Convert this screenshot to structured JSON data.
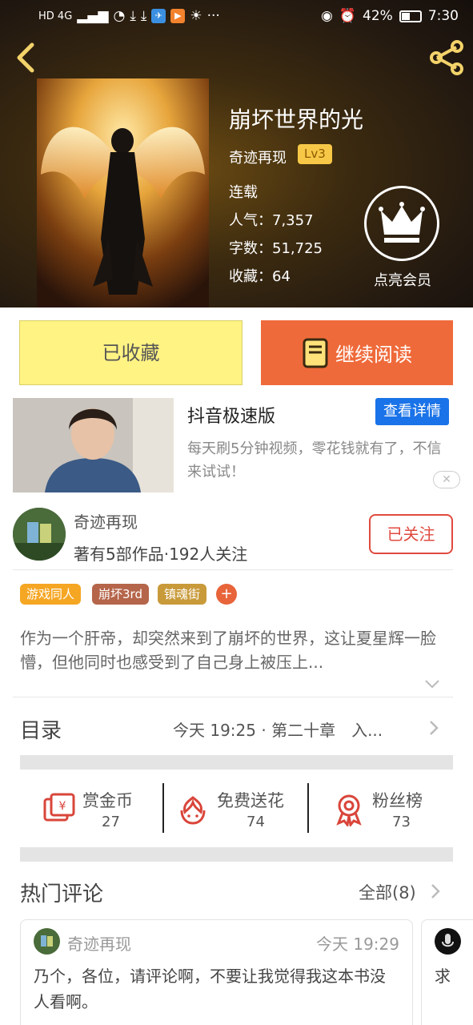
{
  "status_bar": {
    "network": "HD 4G",
    "battery": "42%",
    "time": "7:30"
  },
  "book": {
    "title": "崩坏世界的光",
    "author": "奇迹再现",
    "level": "Lv3",
    "status": "连载",
    "popularity": "人气：7,357",
    "words": "字数：51,725",
    "favorites": "收藏：64"
  },
  "vip": {
    "label": "点亮会员"
  },
  "actions": {
    "favorited_label": "已收藏",
    "continue_label": "继续阅读"
  },
  "ad": {
    "title": "抖音极速版",
    "button": "查看详情",
    "description": "每天刷5分钟视频，零花钱就有了，不信来试试！",
    "close": "✕"
  },
  "author_info": {
    "name": "奇迹再现",
    "stats": "著有5部作品·192人关注",
    "follow_label": "已关注"
  },
  "tags": [
    {
      "label": "游戏同人",
      "color": "#f5a623"
    },
    {
      "label": "崩坏3rd",
      "color": "#b5654a"
    },
    {
      "label": "镇魂街",
      "color": "#c89a3a"
    },
    {
      "label": "+",
      "color": "#e8643a"
    }
  ],
  "synopsis": "作为一个肝帝，却突然来到了崩坏的世界，这让夏星辉一脸懵，但他同时也感受到了自己身上被压上...",
  "toc": {
    "label": "目录",
    "latest": "今天 19:25 · 第二十章　入..."
  },
  "stats": [
    {
      "icon": "money-envelope-icon",
      "label": "赏金币",
      "value": "27"
    },
    {
      "icon": "flower-icon",
      "label": "免费送花",
      "value": "74"
    },
    {
      "icon": "medal-icon",
      "label": "粉丝榜",
      "value": "73"
    }
  ],
  "comments": {
    "section_title": "热门评论",
    "all_label": "全部(8)",
    "items": [
      {
        "user": "奇迹再现",
        "time": "今天 19:29",
        "text": "乃个，各位，请评论啊，不要让我觉得我这本书没人看啊。"
      },
      {
        "text": "求"
      }
    ]
  },
  "colors": {
    "accent_orange": "#ef6a3a",
    "favorite_yellow": "#fff383",
    "follow_red": "#e04a3f",
    "ad_blue": "#1a73e8"
  }
}
